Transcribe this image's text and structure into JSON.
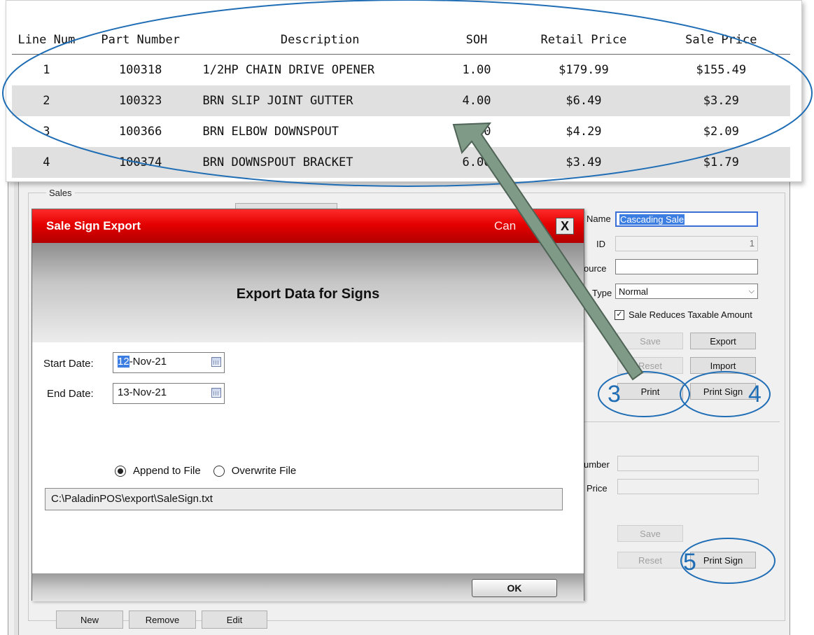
{
  "table": {
    "headers": [
      "Line Num",
      "Part Number",
      "Description",
      "SOH",
      "Retail Price",
      "Sale Price"
    ],
    "rows": [
      {
        "line": "1",
        "part": "100318",
        "desc": "1/2HP CHAIN DRIVE OPENER",
        "soh": "1.00",
        "retail": "$179.99",
        "sale": "$155.49"
      },
      {
        "line": "2",
        "part": "100323",
        "desc": "BRN SLIP JOINT GUTTER",
        "soh": "4.00",
        "retail": "$6.49",
        "sale": "$3.29"
      },
      {
        "line": "3",
        "part": "100366",
        "desc": "BRN ELBOW DOWNSPOUT",
        "soh": "3.00",
        "retail": "$4.29",
        "sale": "$2.09"
      },
      {
        "line": "4",
        "part": "100374",
        "desc": "BRN DOWNSPOUT BRACKET",
        "soh": "6.00",
        "retail": "$3.49",
        "sale": "$1.79"
      }
    ]
  },
  "sales_panel": {
    "group_label": "Sales",
    "name_label": "Name",
    "name_value": "Cascading Sale",
    "id_label": "ID",
    "id_value": "1",
    "source_label": "ource",
    "source_value": "",
    "type_label": "Type",
    "type_value": "Normal",
    "reduces_taxable_label": "Sale Reduces Taxable Amount",
    "save_label": "Save",
    "export_label": "Export",
    "reset_label": "Reset",
    "import_label": "Import",
    "print_label": "Print",
    "print_sign_label": "Print Sign",
    "number_label": "umber",
    "price_label": "Price",
    "save2_label": "Save",
    "reset2_label": "Reset",
    "print_sign2_label": "Print Sign",
    "new_label": "New",
    "remove_label": "Remove",
    "edit_label": "Edit"
  },
  "dialog": {
    "title": "Sale Sign Export",
    "cancel_text": "Can",
    "close_glyph": "X",
    "heading": "Export Data for Signs",
    "start_date_label": "Start Date:",
    "start_date_day": "12",
    "start_date_rest": "-Nov-21",
    "end_date_label": "End Date:",
    "end_date_value": "13-Nov-21",
    "append_label": "Append to File",
    "overwrite_label": "Overwrite File",
    "file_path": "C:\\PaladinPOS\\export\\SaleSign.txt",
    "ok_label": "OK"
  },
  "annotations": {
    "callout_3": "3",
    "callout_4": "4",
    "callout_5": "5",
    "accent_color": "#1f6db5",
    "arrow_color": "#7f9a86"
  }
}
